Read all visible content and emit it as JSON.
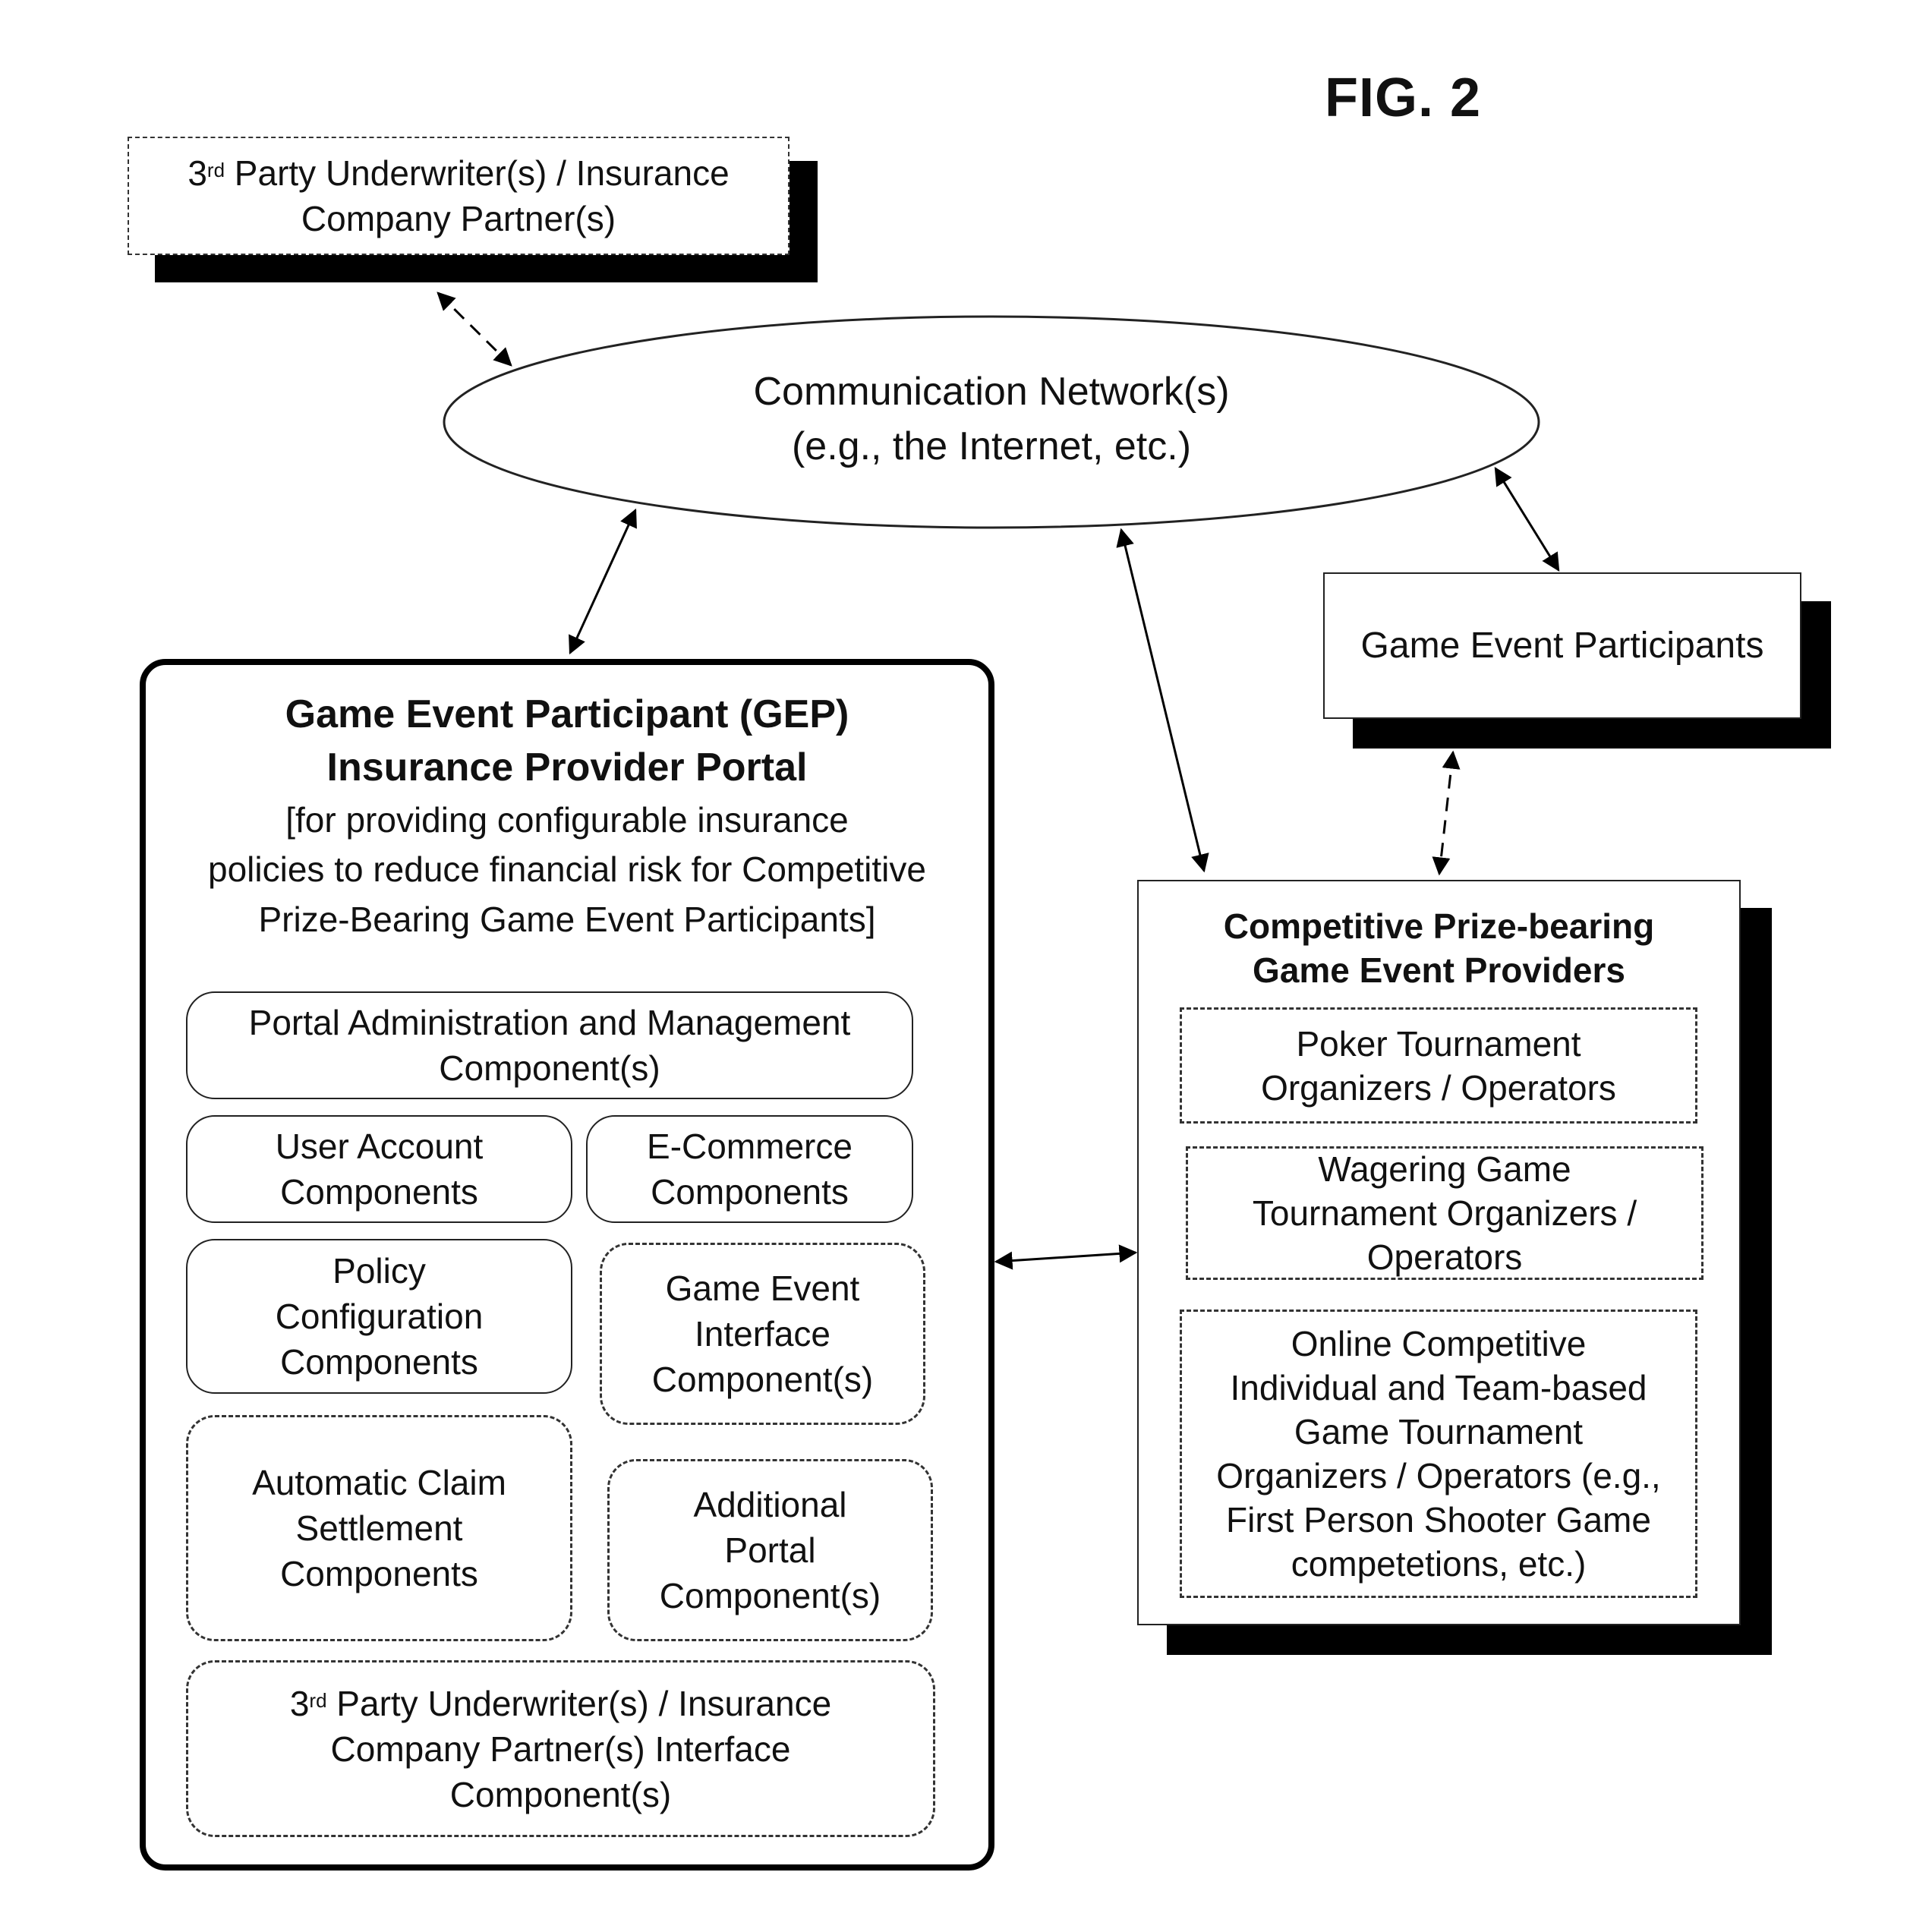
{
  "figure": {
    "label": "FIG. 2"
  },
  "underwriter_box": {
    "line1_pre": "3",
    "line1_sup": "rd",
    "line1_post": " Party Underwriter(s) / Insurance",
    "line2": "Company Partner(s)"
  },
  "network": {
    "line1": "Communication Network(s)",
    "line2": "(e.g., the Internet, etc.)"
  },
  "participants_box": {
    "label": "Game Event Participants"
  },
  "portal": {
    "title_line1": "Game Event Participant (GEP)",
    "title_line2": "Insurance Provider Portal",
    "subtitle_line1": "[for providing configurable insurance",
    "subtitle_line2": "policies to reduce financial risk for Competitive",
    "subtitle_line3": "Prize-Bearing Game Event Participants]",
    "components": {
      "admin": {
        "line1": "Portal Administration and Management",
        "line2": "Component(s)"
      },
      "user_account": {
        "line1": "User Account",
        "line2": "Components"
      },
      "ecommerce": {
        "line1": "E-Commerce",
        "line2": "Components"
      },
      "policy": {
        "line1": "Policy",
        "line2": "Configuration",
        "line3": "Components"
      },
      "game_event_interface": {
        "line1": "Game Event",
        "line2": "Interface",
        "line3": "Component(s)"
      },
      "claim_settlement": {
        "line1": "Automatic Claim",
        "line2": "Settlement",
        "line3": "Components"
      },
      "additional": {
        "line1": "Additional",
        "line2": "Portal",
        "line3": "Component(s)"
      },
      "underwriter_interface": {
        "line1_pre": "3",
        "line1_sup": "rd",
        "line1_post": " Party Underwriter(s) / Insurance",
        "line2": "Company Partner(s) Interface",
        "line3": "Component(s)"
      }
    }
  },
  "providers": {
    "title_line1": "Competitive Prize-bearing",
    "title_line2": "Game Event Providers",
    "items": {
      "poker": {
        "line1": "Poker Tournament",
        "line2": "Organizers / Operators"
      },
      "wagering": {
        "line1": "Wagering Game",
        "line2": "Tournament Organizers /",
        "line3": "Operators"
      },
      "online": {
        "line1": "Online Competitive",
        "line2": "Individual and Team-based",
        "line3": "Game Tournament",
        "line4": "Organizers / Operators (e.g.,",
        "line5": "First Person Shooter Game",
        "line6": "competetions, etc.)"
      }
    }
  }
}
